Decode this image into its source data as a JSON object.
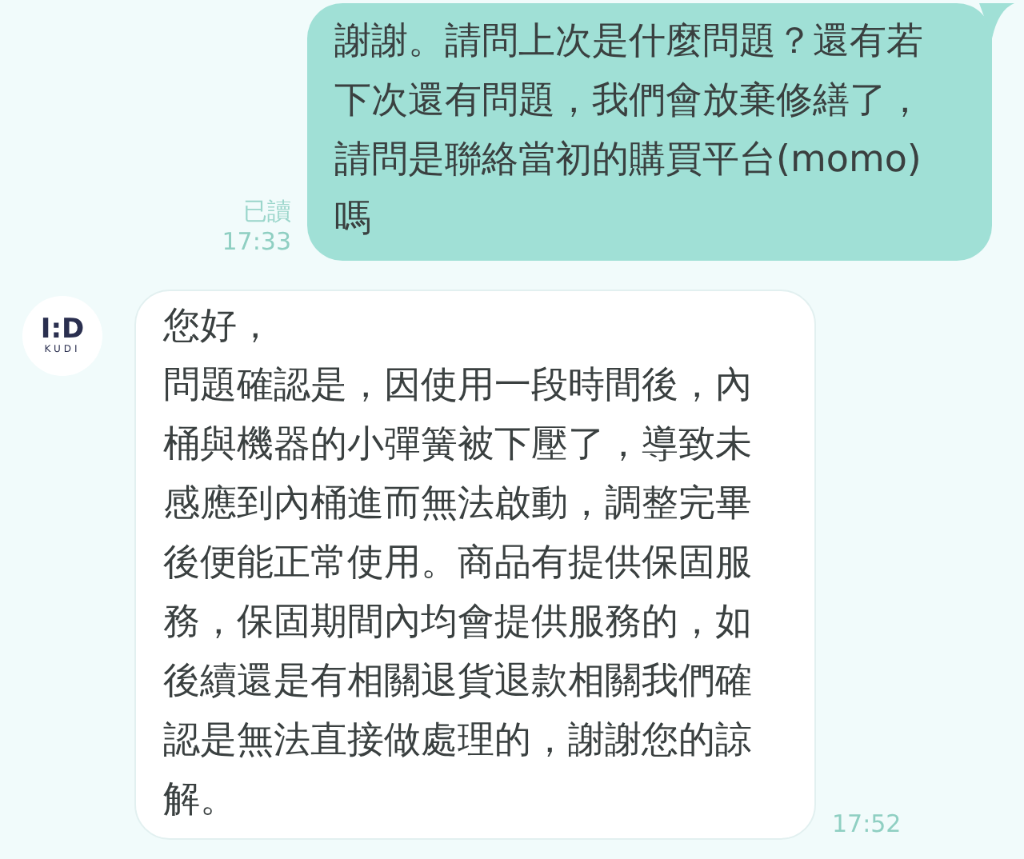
{
  "messages": [
    {
      "kind": "sent",
      "lines": [
        "謝謝。請問上次是什麼問題？還有若",
        "下次還有問題，我們會放棄修繕了，",
        "請問是聯絡當初的購買平台(momo)",
        "嗎"
      ],
      "read_label": "已讀",
      "time": "17:33"
    },
    {
      "kind": "received",
      "avatar": {
        "logo": "I:D",
        "logo_caption": "KUDI"
      },
      "lines": [
        "您好，",
        "問題確認是，因使用一段時間後，內",
        "桶與機器的小彈簧被下壓了，導致未",
        "感應到內桶進而無法啟動，調整完畢",
        "後便能正常使用。商品有提供保固服",
        "務，保固期間內均會提供服務的，如",
        "後續還是有相關退貨退款相關我們確",
        "認是無法直接做處理的，謝謝您的諒",
        "解。"
      ],
      "time": "17:52"
    }
  ]
}
